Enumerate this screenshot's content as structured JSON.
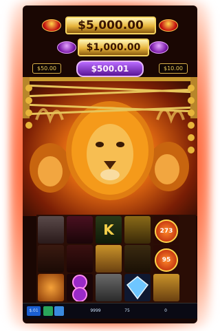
{
  "jackpots": {
    "grand": "$5,000.00",
    "major": "$1,000.00",
    "mini_left": "$50.00",
    "mini_right": "$10.00",
    "mid": "$500.01"
  },
  "reels": {
    "symbol_k": "K",
    "badge_top": "273",
    "badge_bottom": "95"
  },
  "footer": {
    "left_btn": "$.01",
    "credit": "9999",
    "bet": "75",
    "win": "0"
  },
  "colors": {
    "glow": "#ff3a12",
    "gold": "#e7b43a",
    "purple": "#7a1aa8"
  }
}
